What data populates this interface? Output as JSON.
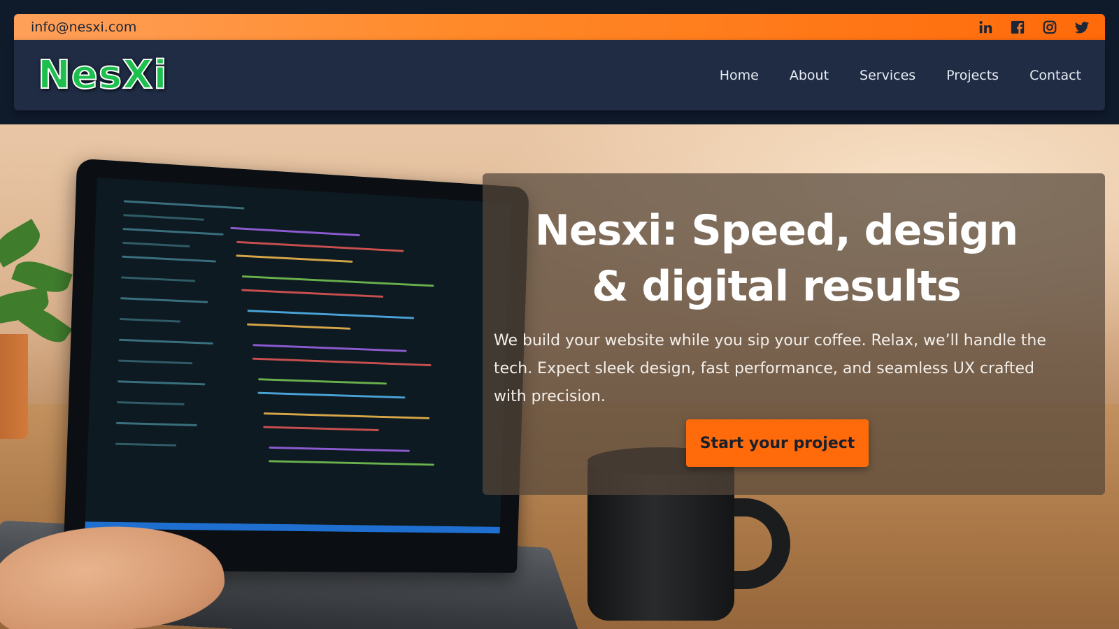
{
  "topbar": {
    "email": "info@nesxi.com",
    "social": [
      {
        "name": "linkedin-icon",
        "glyph": "in"
      },
      {
        "name": "facebook-icon",
        "glyph": "f"
      },
      {
        "name": "instagram-icon",
        "glyph": ""
      },
      {
        "name": "twitter-icon",
        "glyph": ""
      }
    ],
    "colors": {
      "bar_start": "#ffa05a",
      "bar_end": "#ff6a0a",
      "icon": "#1c2636"
    }
  },
  "navbar": {
    "logo": "NesXi",
    "links": [
      "Home",
      "About",
      "Services",
      "Projects",
      "Contact"
    ],
    "colors": {
      "background": "#1f2c44",
      "logo": "#1fbf4f",
      "link": "#e8edf5"
    }
  },
  "hero": {
    "title": "Nesxi: Speed, design & digital results",
    "text": "We build your website while you sip your coffee. Relax, we’ll handle the tech. Expect sleek design, fast performance, and seamless UX crafted with precision.",
    "cta": "Start your project",
    "colors": {
      "cta_background": "#ff6a0a",
      "card_overlay": "rgba(85,70,58,0.72)"
    }
  }
}
